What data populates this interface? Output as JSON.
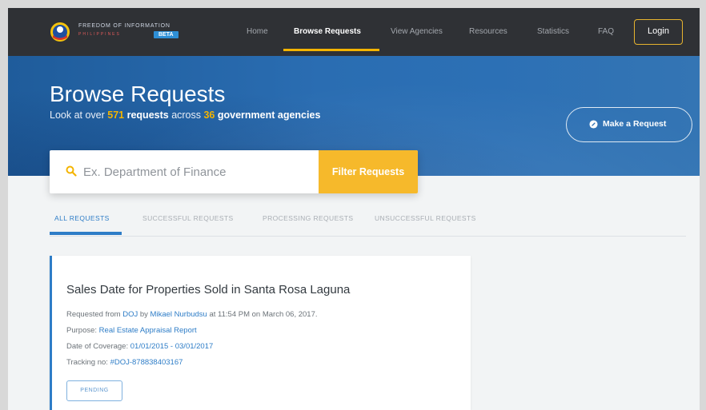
{
  "nav": {
    "logo_title": "FREEDOM OF INFORMATION",
    "logo_subtitle": "PHILIPPINES",
    "beta_badge": "BETA",
    "links": [
      {
        "label": "Home"
      },
      {
        "label": "Browse Requests"
      },
      {
        "label": "View Agencies"
      },
      {
        "label": "Resources"
      },
      {
        "label": "Statistics"
      },
      {
        "label": "FAQ"
      }
    ],
    "login_label": "Login"
  },
  "hero": {
    "title": "Browse Requests",
    "subtitle_prefix": "Look at over ",
    "request_count": "571",
    "requests_word": "requests",
    "subtitle_mid": " across ",
    "agency_count": "36",
    "agencies_words": "government agencies",
    "make_request_label": "Make a Request"
  },
  "search": {
    "placeholder": "Ex. Department of Finance",
    "filter_label": "Filter Requests"
  },
  "tabs": [
    {
      "label": "ALL REQUESTS"
    },
    {
      "label": "SUCCESSFUL REQUESTS"
    },
    {
      "label": "PROCESSING REQUESTS"
    },
    {
      "label": "UNSUCCESSFUL REQUESTS"
    }
  ],
  "request": {
    "title": "Sales Date for Properties Sold in Santa Rosa Laguna",
    "requested_prefix": "Requested from ",
    "agency": "DOJ",
    "by_text": " by ",
    "requester": "Mikael Nurbudsu",
    "time_text": " at 11:54 PM on March 06, 2017.",
    "purpose_prefix": "Purpose: ",
    "purpose": "Real Estate Appraisal Report",
    "coverage_prefix": "Date of Coverage: ",
    "coverage": "01/01/2015 - 03/01/2017",
    "tracking_prefix": "Tracking no: ",
    "tracking": "#DOJ-878838403167",
    "status": "PENDING"
  },
  "colors": {
    "nav_bg": "#2f3135",
    "accent_yellow": "#f4b400",
    "primary_blue": "#2e7dc7",
    "hero_blue": "#2a6db2"
  },
  "icons": {
    "search": "search-icon",
    "make_request": "pencil-icon"
  }
}
